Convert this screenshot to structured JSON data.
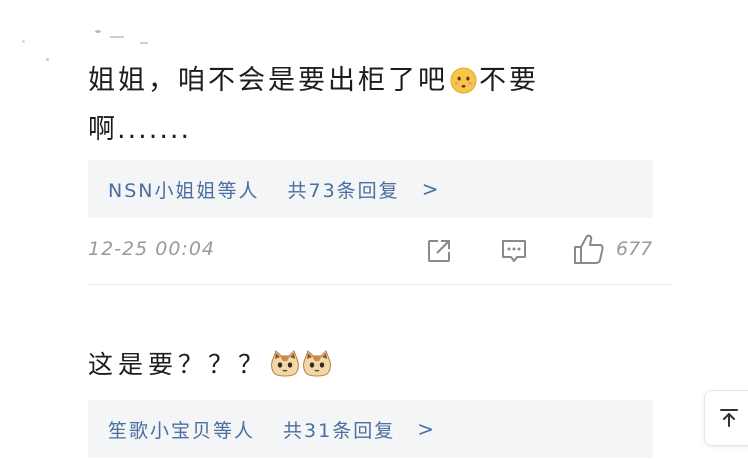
{
  "comments": [
    {
      "text_line1_a": "姐姐，咱不会是要出柜了吧",
      "emoji": "worried-face-emoji",
      "text_line1_b": "不要",
      "text_line2": "啊.......",
      "reply": {
        "names": "NSN小姐姐等人",
        "count_text": "共73条回复",
        "chevron": ">"
      },
      "timestamp": "12-25 00:04",
      "like_count": "677",
      "icons": [
        "share-icon",
        "comment-icon",
        "thumbs-up-icon"
      ]
    },
    {
      "text": "这是要？？？",
      "emojis": [
        "cat-face-emoji",
        "cat-face-emoji"
      ],
      "reply": {
        "names": "笙歌小宝贝等人",
        "count_text": "共31条回复",
        "chevron": ">"
      }
    }
  ],
  "back_to_top_icon": "arrow-up-to-top-icon",
  "colors": {
    "reply_text": "#4a6fa0",
    "reply_bg": "#f3f5f7",
    "meta_text": "#9a9a9a",
    "body_text": "#1d1d1d"
  }
}
